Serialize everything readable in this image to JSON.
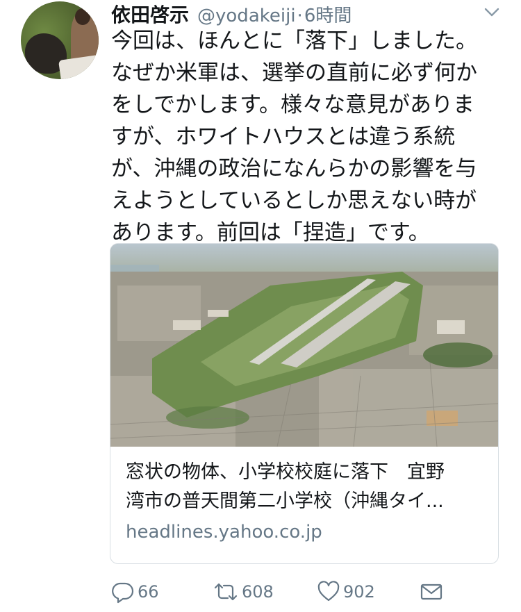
{
  "tweet": {
    "author_name": "依田啓示",
    "handle": "@yodakeiji",
    "separator": "·",
    "time": "6時間",
    "text_lines": [
      "今回は、ほんとに「落下」しました。",
      "なぜか米軍は、選挙の直前に必ず何か",
      "をしでかします。様々な意見がありま",
      "すが、ホワイトハウスとは違う系統",
      "が、沖縄の政治になんらかの影響を与",
      "えようとしているとしか思えない時が",
      "あります。前回は「捏造」です。"
    ]
  },
  "card": {
    "title_lines": [
      "窓状の物体、小学校校庭に落下　宜野",
      "湾市の普天間第二小学校（沖縄タイ..."
    ],
    "domain": "headlines.yahoo.co.jp"
  },
  "actions": {
    "reply_count": "66",
    "retweet_count": "608",
    "like_count": "902"
  },
  "colors": {
    "text": "#14171a",
    "secondary": "#657786",
    "border": "#d8dee3"
  },
  "icons": [
    "chevron-down-icon",
    "reply-icon",
    "retweet-icon",
    "heart-icon",
    "mail-icon"
  ]
}
